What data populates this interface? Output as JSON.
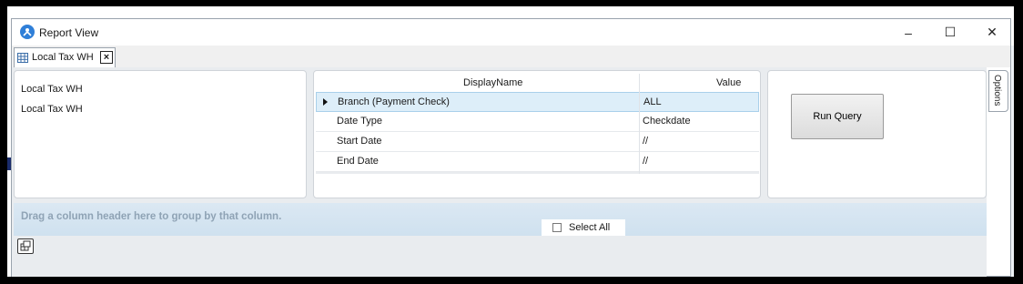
{
  "window": {
    "title": "Report View",
    "controls": {
      "minimize": "–",
      "maximize": "☐",
      "close": "✕"
    }
  },
  "tab": {
    "label": "Local Tax WH",
    "close": "×"
  },
  "reports": {
    "items": [
      "Local Tax WH",
      "Local Tax WH"
    ]
  },
  "parameters": {
    "headers": {
      "display_name": "DisplayName",
      "value": "Value"
    },
    "rows": [
      {
        "name": "Branch (Payment Check)",
        "value": "ALL"
      },
      {
        "name": "Date Type",
        "value": "Checkdate"
      },
      {
        "name": "Start Date",
        "value": "//"
      },
      {
        "name": "End Date",
        "value": "//"
      }
    ]
  },
  "actions": {
    "run_query": "Run Query",
    "options": "Options"
  },
  "group_panel": {
    "hint": "Drag a column header here to group by that column."
  },
  "select_all": {
    "label": "Select All",
    "checked": false
  },
  "colors": {
    "accent": "#2f7fd8",
    "group_bar": "#d6e6f2",
    "selected_row": "#ddeef9"
  }
}
